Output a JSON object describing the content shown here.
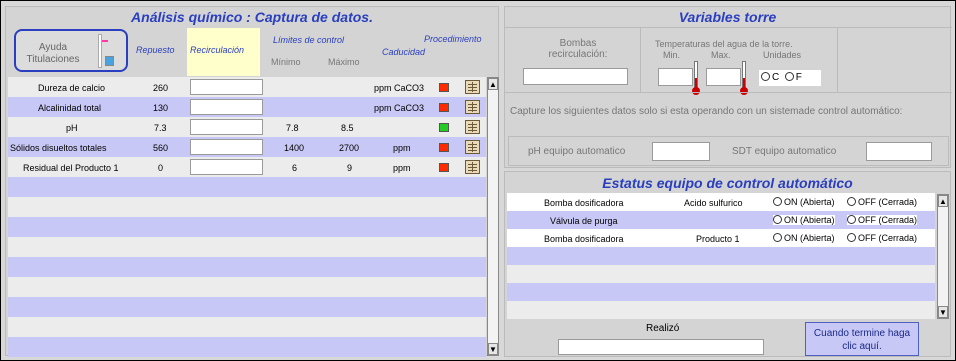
{
  "left_panel": {
    "title": "Análisis químico : Captura de datos.",
    "ayuda_button": "Ayuda\nTitulaciones",
    "headers": {
      "repuesto": "Repuesto",
      "recirculacion": "Recirculación",
      "limites": "Límites de control",
      "minimo": "Mínimo",
      "maximo": "Máximo",
      "caducidad": "Caducidad",
      "procedimiento": "Procedimiento"
    },
    "rows": [
      {
        "name": "Dureza de calcio",
        "repuesto": "260",
        "min": "",
        "max": "",
        "unit": "ppm CaCO3",
        "status": "red"
      },
      {
        "name": "Alcalinidad total",
        "repuesto": "130",
        "min": "",
        "max": "",
        "unit": "ppm CaCO3",
        "status": "red"
      },
      {
        "name": "pH",
        "repuesto": "7.3",
        "min": "7.8",
        "max": "8.5",
        "unit": "",
        "status": "green"
      },
      {
        "name": "Sólidos disueltos totales",
        "repuesto": "560",
        "min": "1400",
        "max": "2700",
        "unit": "ppm",
        "status": "red"
      },
      {
        "name": "Residual del Producto 1",
        "repuesto": "0",
        "min": "6",
        "max": "9",
        "unit": "ppm",
        "status": "red"
      }
    ],
    "colors": {
      "red": "#ff2a00",
      "green": "#22cc22"
    }
  },
  "right_panel": {
    "title": "Variables torre",
    "bombas_label": "Bombas\nrecirculación:",
    "temperaturas_label": "Temperaturas del agua de la torre.",
    "min_label": "Min.",
    "max_label": "Max.",
    "unidades_label": "Unidades",
    "unit_c": "C",
    "unit_f": "F",
    "instruction": "Capture los siguientes datos solo si esta operando con un sistemade control automático:",
    "ph_label": "pH equipo automatico",
    "sdt_label": "SDT equipo automatico"
  },
  "status_panel": {
    "title": "Estatus equipo de control automático",
    "rows": [
      {
        "device": "Bomba dosificadora",
        "product": "Acido sulfurico",
        "on": "ON (Abierta)",
        "off": "OFF (Cerrada)"
      },
      {
        "device": "Válvula de purga",
        "product": "",
        "on": "ON (Abierta)",
        "off": "OFF (Cerrada)"
      },
      {
        "device": "Bomba dosificadora",
        "product": "Producto 1",
        "on": "ON (Abierta)",
        "off": "OFF (Cerrada)"
      }
    ],
    "realizo_label": "Realizó",
    "done_button": "Cuando termine haga\nclic aquí."
  }
}
